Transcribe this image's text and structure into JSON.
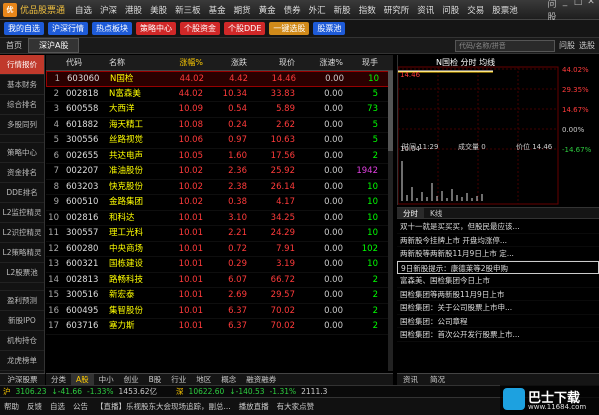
{
  "app": {
    "logo_text": "优",
    "title": "优品股票通",
    "menu": [
      "自选",
      "沪深",
      "港股",
      "美股",
      "新三板",
      "基金",
      "期货",
      "黄金",
      "债券",
      "外汇",
      "新股",
      "指数",
      "研究所",
      "资讯",
      "问股",
      "交易",
      "股票池"
    ],
    "window_buttons": [
      "问股",
      "_",
      "□",
      "✕"
    ]
  },
  "toolbar": {
    "buttons": [
      {
        "label": "我的自选",
        "color": "#1e5bd8"
      },
      {
        "label": "沪深行情",
        "color": "#1e5bd8"
      },
      {
        "label": "热点板块",
        "color": "#1e5bd8"
      },
      {
        "label": "策略中心",
        "color": "#d02828"
      },
      {
        "label": "个股资金",
        "color": "#d02828"
      },
      {
        "label": "个股DDE",
        "color": "#d02828"
      },
      {
        "label": "一键选股",
        "color": "#d08a1a"
      },
      {
        "label": "股票池",
        "color": "#1e5bd8"
      }
    ]
  },
  "tabbar": {
    "home": "首页",
    "tab": "深沪A股",
    "search_placeholder": "代码/名称/拼音",
    "buttons": [
      "问股",
      "选股"
    ]
  },
  "sidebar": {
    "items": [
      "行情报价",
      "基本财务",
      "综合排名",
      "多股同列",
      "",
      "策略中心",
      "资金排名",
      "DDE排名",
      "L2监控精灵",
      "L2识控精灵",
      "L2策略精灵",
      "L2股票池",
      "",
      "盈利预测",
      "新股IPO",
      "机构持仓",
      "龙虎榜单"
    ],
    "active_index": 0,
    "bottom_tab": "沪深股票"
  },
  "table": {
    "headers": {
      "code": "代码",
      "name": "名称",
      "chg": "涨幅%",
      "fall": "涨跌",
      "price": "现价",
      "speed": "涨速%",
      "hand": "现手"
    },
    "rows": [
      {
        "idx": "1",
        "code": "603060",
        "name": "N国检",
        "chg": "44.02",
        "fall": "4.42",
        "price": "14.46",
        "speed": "0.00",
        "hand": "10"
      },
      {
        "idx": "2",
        "code": "002818",
        "name": "N富森美",
        "chg": "44.02",
        "fall": "10.34",
        "price": "33.83",
        "speed": "0.00",
        "hand": "5"
      },
      {
        "idx": "3",
        "code": "600558",
        "name": "大西洋",
        "chg": "10.09",
        "fall": "0.54",
        "price": "5.89",
        "speed": "0.00",
        "hand": "73"
      },
      {
        "idx": "4",
        "code": "601882",
        "name": "海天精工",
        "chg": "10.08",
        "fall": "0.24",
        "price": "2.62",
        "speed": "0.00",
        "hand": "5"
      },
      {
        "idx": "5",
        "code": "300556",
        "name": "丝路视觉",
        "chg": "10.06",
        "fall": "0.97",
        "price": "10.63",
        "speed": "0.00",
        "hand": "5"
      },
      {
        "idx": "6",
        "code": "002655",
        "name": "共达电声",
        "chg": "10.05",
        "fall": "1.60",
        "price": "17.56",
        "speed": "0.00",
        "hand": "2"
      },
      {
        "idx": "7",
        "code": "002207",
        "name": "准油股份",
        "chg": "10.02",
        "fall": "2.36",
        "price": "25.92",
        "speed": "0.00",
        "hand": "1942"
      },
      {
        "idx": "8",
        "code": "603203",
        "name": "快克股份",
        "chg": "10.02",
        "fall": "2.38",
        "price": "26.14",
        "speed": "0.00",
        "hand": "10"
      },
      {
        "idx": "9",
        "code": "600510",
        "name": "金路集团",
        "chg": "10.02",
        "fall": "0.38",
        "price": "4.17",
        "speed": "0.00",
        "hand": "10"
      },
      {
        "idx": "10",
        "code": "002816",
        "name": "和科达",
        "chg": "10.01",
        "fall": "3.10",
        "price": "34.25",
        "speed": "0.00",
        "hand": "10"
      },
      {
        "idx": "11",
        "code": "300557",
        "name": "理工光科",
        "chg": "10.01",
        "fall": "2.21",
        "price": "24.29",
        "speed": "0.00",
        "hand": "10"
      },
      {
        "idx": "12",
        "code": "600280",
        "name": "中央商场",
        "chg": "10.01",
        "fall": "0.72",
        "price": "7.91",
        "speed": "0.00",
        "hand": "102"
      },
      {
        "idx": "13",
        "code": "600321",
        "name": "国栋建设",
        "chg": "10.01",
        "fall": "0.29",
        "price": "3.19",
        "speed": "0.00",
        "hand": "10"
      },
      {
        "idx": "14",
        "code": "002813",
        "name": "路畅科技",
        "chg": "10.01",
        "fall": "6.07",
        "price": "66.72",
        "speed": "0.00",
        "hand": "2"
      },
      {
        "idx": "15",
        "code": "300516",
        "name": "新宏泰",
        "chg": "10.01",
        "fall": "2.69",
        "price": "29.57",
        "speed": "0.00",
        "hand": "2"
      },
      {
        "idx": "16",
        "code": "600495",
        "name": "集智股份",
        "chg": "10.01",
        "fall": "6.37",
        "price": "70.02",
        "speed": "0.00",
        "hand": "2"
      },
      {
        "idx": "17",
        "code": "603716",
        "name": "塞力斯",
        "chg": "10.01",
        "fall": "6.37",
        "price": "70.02",
        "speed": "0.00",
        "hand": "2"
      }
    ],
    "bottom_tabs": [
      "分类",
      "A股",
      "中小",
      "创业",
      "B股",
      "行业",
      "地区",
      "概念",
      "融资融券"
    ],
    "bottom_active": 1
  },
  "chart": {
    "title": "N国检  分时  均线",
    "left_labels": [
      "14.46",
      "",
      "",
      "",
      "10.04"
    ],
    "right_labels": [
      "44.02%",
      "29.35%",
      "14.67%",
      "0.00%",
      "-14.67%"
    ],
    "time_label": "时间",
    "time_value": "11:29",
    "volume_label": "成交量",
    "volume_value": "0",
    "price_label": "价位",
    "price_value": "14.46"
  },
  "news": {
    "tabs": [
      "分时",
      "K线"
    ],
    "items": [
      "双十一就是买买买，但股民最应该...",
      "两新股今挂牌上市 开盘均涨停...",
      "两新股等两新股11月9日上市 定...",
      "9日新股提示：康德莱等2股申购",
      "富森美、国检集团今日上市",
      "国检集团等两新股11月9日上市",
      "国检集团：关于公司股票上市申...",
      "国检集团：公司章程",
      "国检集团：首次公开发行股票上市..."
    ],
    "highlight_index": 3,
    "bottom_tabs": [
      "资讯",
      "简况"
    ]
  },
  "status": {
    "sh_label": "沪",
    "sh_value": "3106.23",
    "sh_chg": "↓-41.66",
    "sh_pct": "-1.33%",
    "sh_vol": "1453.62亿",
    "sz_label": "深",
    "sz_value": "10622.60",
    "sz_chg": "↓-140.53",
    "sz_pct": "-1.31%",
    "sz_vol": "2111.3",
    "bottom_items": [
      "帮助",
      "反馈",
      "自选",
      "公告",
      "【直播】乐视股东大会现场追踪，副总...",
      "播放直播",
      "有大家点赞"
    ]
  },
  "watermark": {
    "title": "巴士下载",
    "url": "www.11684.com"
  },
  "colors": {
    "up": "#ff3b3b",
    "down": "#2ecc40",
    "name": "#ffff00",
    "active_side": "#c0392b"
  }
}
